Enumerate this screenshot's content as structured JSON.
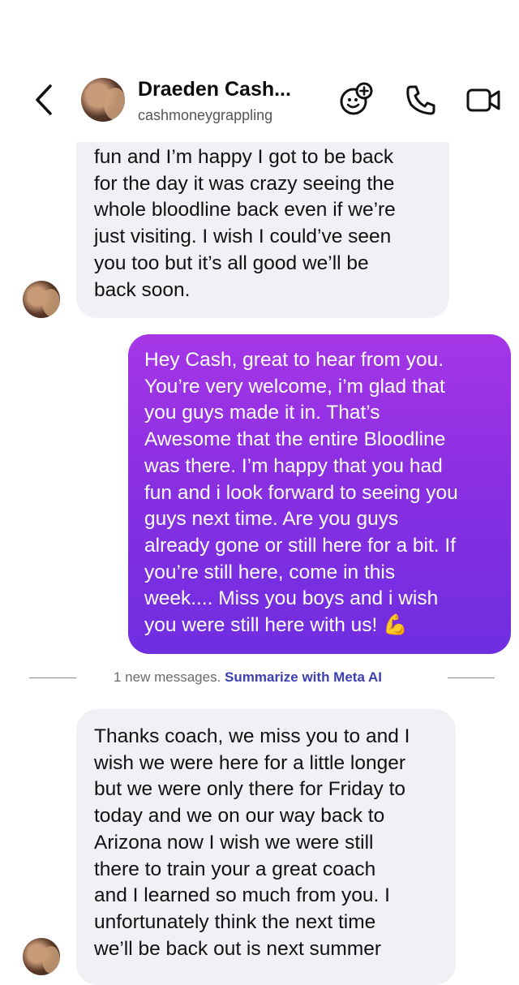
{
  "header": {
    "contact_name": "Draeden Cash...",
    "contact_handle": "cashmoneygrappling",
    "icons": [
      "back-chevron-icon",
      "effects-icon",
      "phone-icon",
      "video-camera-icon"
    ]
  },
  "conversation": {
    "first_incoming": {
      "lines": [
        "fun and I’m happy I got to be back",
        "for the day it was crazy seeing the",
        "whole bloodline back even if we’re",
        "just visiting. I wish I could’ve seen",
        "you too but it’s all good we’ll be",
        "back soon."
      ]
    },
    "outgoing": {
      "lines": [
        "Hey Cash, great to hear from you.",
        "You’re very welcome, i’m glad that",
        "you guys made it in. That’s",
        "Awesome that the entire Bloodline",
        "was there. I’m happy that you had",
        "fun and i look forward to seeing you",
        "guys next time. Are you guys",
        "already gone or still here for a bit. If",
        "you’re still here, come in this",
        "week.... Miss you boys and i wish",
        "you were still here with us! 💪"
      ],
      "colors": {
        "top": "#a536e6",
        "bottom": "#6f2ee0"
      }
    },
    "new_messages_divider": {
      "count_text": "1 new messages.",
      "link_text": "Summarize with Meta AI",
      "link_color": "#3b3fb0"
    },
    "second_incoming": {
      "lines": [
        "Thanks coach, we miss you to and I",
        "wish we were here for a little longer",
        "but we were only there for Friday to",
        "today and we on our way back to",
        "Arizona now I wish we were still",
        "there to train your a great coach",
        "and I learned so much from you. I",
        "unfortunately think the next time",
        "we’ll be back out is next summer"
      ]
    }
  }
}
